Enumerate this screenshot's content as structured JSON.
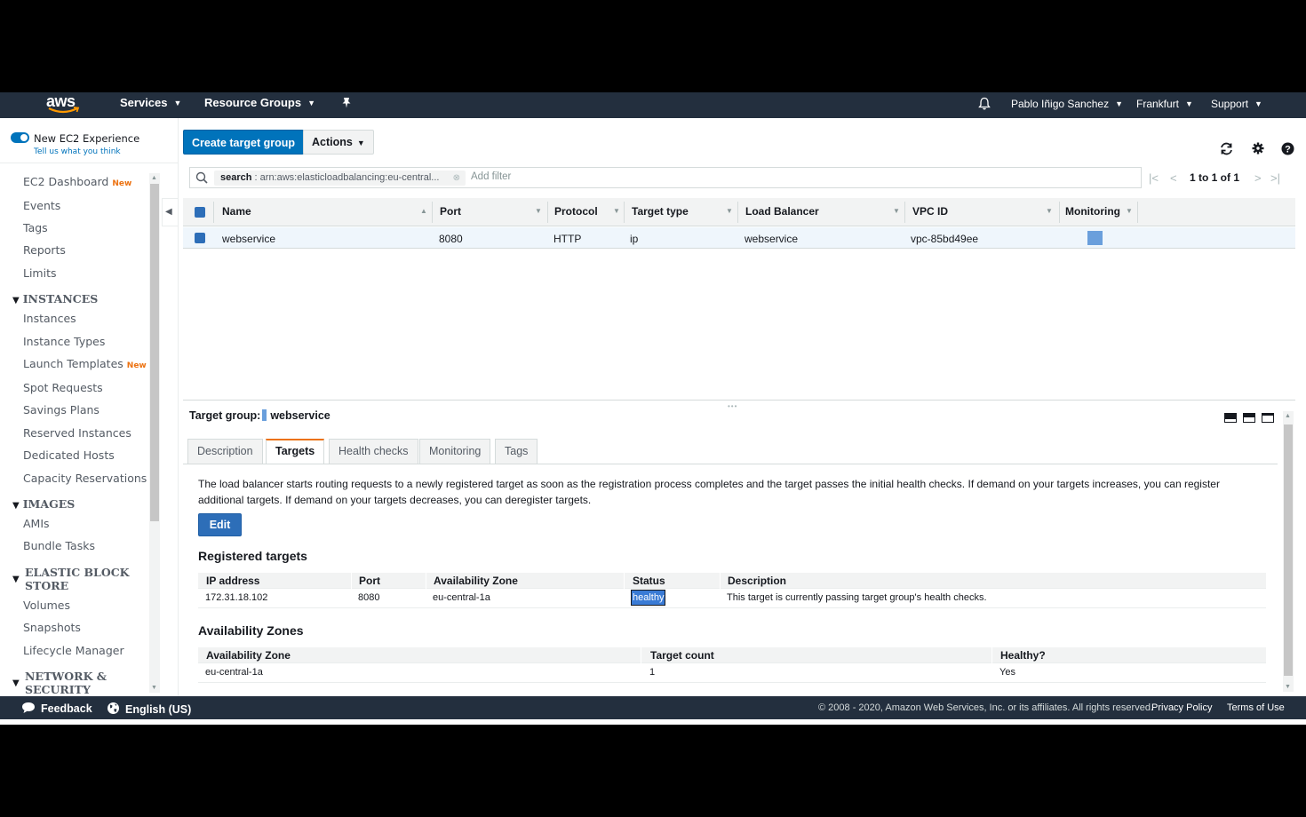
{
  "nav": {
    "logo": "aws",
    "services": "Services",
    "resource_groups": "Resource Groups",
    "user": "Pablo Iñigo Sanchez",
    "region": "Frankfurt",
    "support": "Support"
  },
  "sidebar": {
    "new_experience": "New EC2 Experience",
    "tell_us": "Tell us what you think",
    "items": [
      {
        "label": "EC2 Dashboard",
        "badge": "New"
      },
      {
        "label": "Events"
      },
      {
        "label": "Tags"
      },
      {
        "label": "Reports"
      },
      {
        "label": "Limits"
      }
    ],
    "instances_header": "INSTANCES",
    "instances": [
      {
        "label": "Instances"
      },
      {
        "label": "Instance Types"
      },
      {
        "label": "Launch Templates",
        "badge": "New"
      },
      {
        "label": "Spot Requests"
      },
      {
        "label": "Savings Plans"
      },
      {
        "label": "Reserved Instances"
      },
      {
        "label": "Dedicated Hosts"
      },
      {
        "label": "Capacity Reservations"
      }
    ],
    "images_header": "IMAGES",
    "images": [
      {
        "label": "AMIs"
      },
      {
        "label": "Bundle Tasks"
      }
    ],
    "ebs_header_1": "ELASTIC BLOCK",
    "ebs_header_2": "STORE",
    "ebs": [
      {
        "label": "Volumes"
      },
      {
        "label": "Snapshots"
      },
      {
        "label": "Lifecycle Manager"
      }
    ],
    "network_header_1": "NETWORK &",
    "network_header_2": "SECURITY"
  },
  "toolbar": {
    "create_label": "Create target group",
    "actions_label": "Actions"
  },
  "filter": {
    "chip_key": "search",
    "chip_value": ": arn:aws:elasticloadbalancing:eu-central...",
    "add_filter": "Add filter",
    "pager_text": "1 to 1 of 1"
  },
  "grid": {
    "columns": [
      "Name",
      "Port",
      "Protocol",
      "Target type",
      "Load Balancer",
      "VPC ID",
      "Monitoring"
    ],
    "row": {
      "name": "webservice",
      "port": "8080",
      "protocol": "HTTP",
      "target_type": "ip",
      "load_balancer": "webservice",
      "vpc_id": "vpc-85bd49ee"
    }
  },
  "detail": {
    "title_prefix": "Target group:",
    "title_name": "webservice",
    "tabs": [
      "Description",
      "Targets",
      "Health checks",
      "Monitoring",
      "Tags"
    ],
    "active_tab": "Targets",
    "info_text": "The load balancer starts routing requests to a newly registered target as soon as the registration process completes and the target passes the initial health checks. If demand on your targets increases, you can register additional targets. If demand on your targets decreases, you can deregister targets.",
    "edit_label": "Edit",
    "registered_title": "Registered targets",
    "registered_columns": [
      "IP address",
      "Port",
      "Availability Zone",
      "Status",
      "Description"
    ],
    "registered_rows": [
      {
        "ip": "172.31.18.102",
        "port": "8080",
        "az": "eu-central-1a",
        "status": "healthy",
        "description": "This target is currently passing target group's health checks."
      }
    ],
    "az_title": "Availability Zones",
    "az_columns": [
      "Availability Zone",
      "Target count",
      "Healthy?"
    ],
    "az_rows": [
      {
        "az": "eu-central-1a",
        "count": "1",
        "healthy": "Yes"
      }
    ]
  },
  "footer": {
    "feedback": "Feedback",
    "language": "English (US)",
    "copyright": "© 2008 - 2020, Amazon Web Services, Inc. or its affiliates. All rights reserved.",
    "privacy": "Privacy Policy",
    "terms": "Terms of Use"
  },
  "colors": {
    "nav_bg": "#232f3e",
    "primary": "#0073bb",
    "accent_tab": "#ec7211",
    "selection": "#eff6fc"
  }
}
